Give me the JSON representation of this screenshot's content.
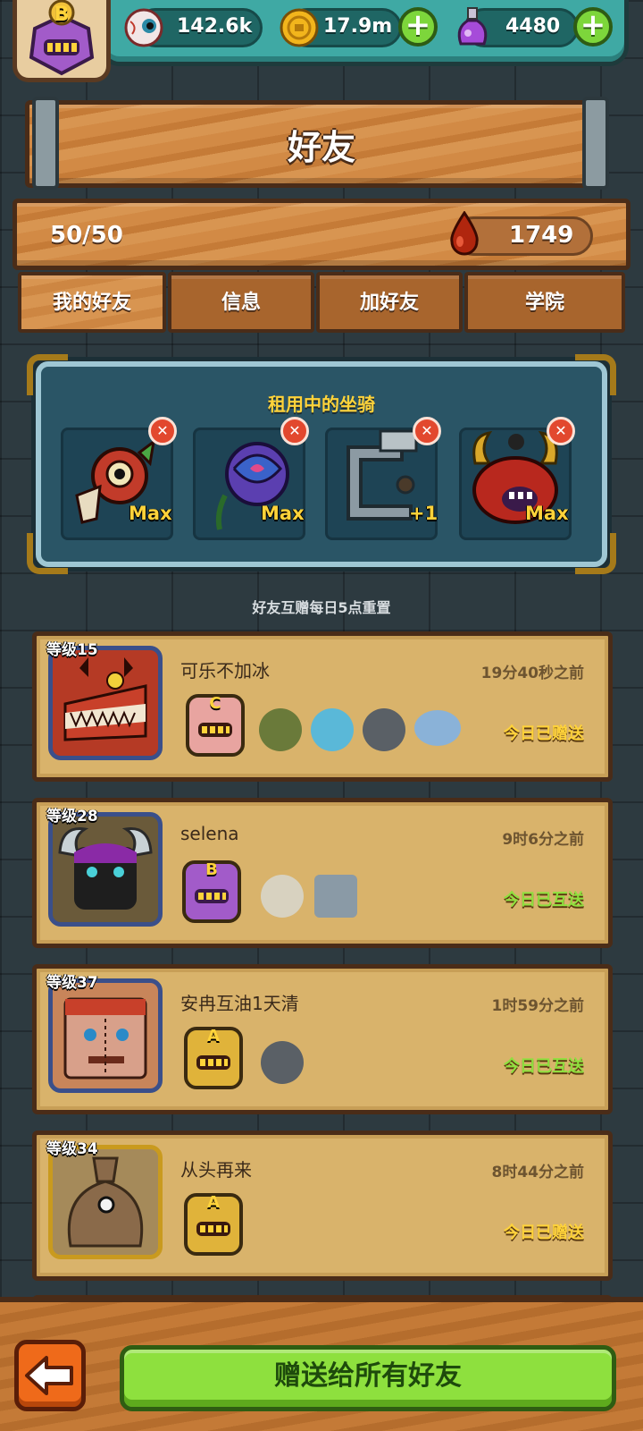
{
  "header": {
    "rank_letter": "B",
    "resources": [
      {
        "icon": "eyeball-icon",
        "value": "142.6k"
      },
      {
        "icon": "gold-coin-icon",
        "value": "17.9m"
      },
      {
        "icon": "potion-flask-icon",
        "value": "4480"
      }
    ]
  },
  "page": {
    "title": "好友",
    "friend_count": "50/50",
    "drop_value": "1749"
  },
  "tabs": [
    {
      "label": "我的好友",
      "active": true
    },
    {
      "label": "信息",
      "active": false
    },
    {
      "label": "加好友",
      "active": false
    },
    {
      "label": "学院",
      "active": false
    }
  ],
  "mounts": {
    "title": "租用中的坐骑",
    "slots": [
      {
        "name": "dragon-mount-icon",
        "level": "Max",
        "color": "#c23b2a"
      },
      {
        "name": "rose-mount-icon",
        "level": "Max",
        "color": "#5b3fb0"
      },
      {
        "name": "robot-arm-mount-icon",
        "level": "+1",
        "color": "#8c9aa3"
      },
      {
        "name": "horned-demon-mount-icon",
        "level": "Max",
        "color": "#b8281e"
      }
    ]
  },
  "reset_note": "好友互赠每日5点重置",
  "friends": [
    {
      "level": "等级15",
      "name": "可乐不加冰",
      "time": "19分40秒之前",
      "status": "今日已赠送",
      "status_color": "#ffd33a",
      "avatar_color": "#b53a25",
      "rank": "C",
      "rank_color": "#e8a4a0",
      "mini_mounts": [
        "turtle-mount-icon",
        "pufferfish-mount-icon",
        "drill-mount-icon",
        "ufo-mount-icon"
      ]
    },
    {
      "level": "等级28",
      "name": "selena",
      "time": "9时6分之前",
      "status": "今日已互送",
      "status_color": "#8ee03e",
      "avatar_color": "#2a2a2a",
      "rank": "B",
      "rank_color": "#a25bc9",
      "mini_mounts": [
        "moon-orb-icon",
        "cabinet-robot-icon"
      ]
    },
    {
      "level": "等级37",
      "name": "安冉互油1天清",
      "time": "1时59分之前",
      "status": "今日已互送",
      "status_color": "#8ee03e",
      "avatar_color": "#b8806a",
      "rank": "A",
      "rank_color": "#e0b33a",
      "mini_mounts": [
        "drill-mount-icon"
      ]
    },
    {
      "level": "等级34",
      "name": "从头再来",
      "time": "8时44分之前",
      "status": "今日已赠送",
      "status_color": "#ffd33a",
      "avatar_color": "#a58a5a",
      "rank": "A",
      "rank_color": "#e0b33a",
      "mini_mounts": []
    }
  ],
  "bottom": {
    "back_icon": "back-arrow-icon",
    "gift_all_label": "赠送给所有好友"
  }
}
